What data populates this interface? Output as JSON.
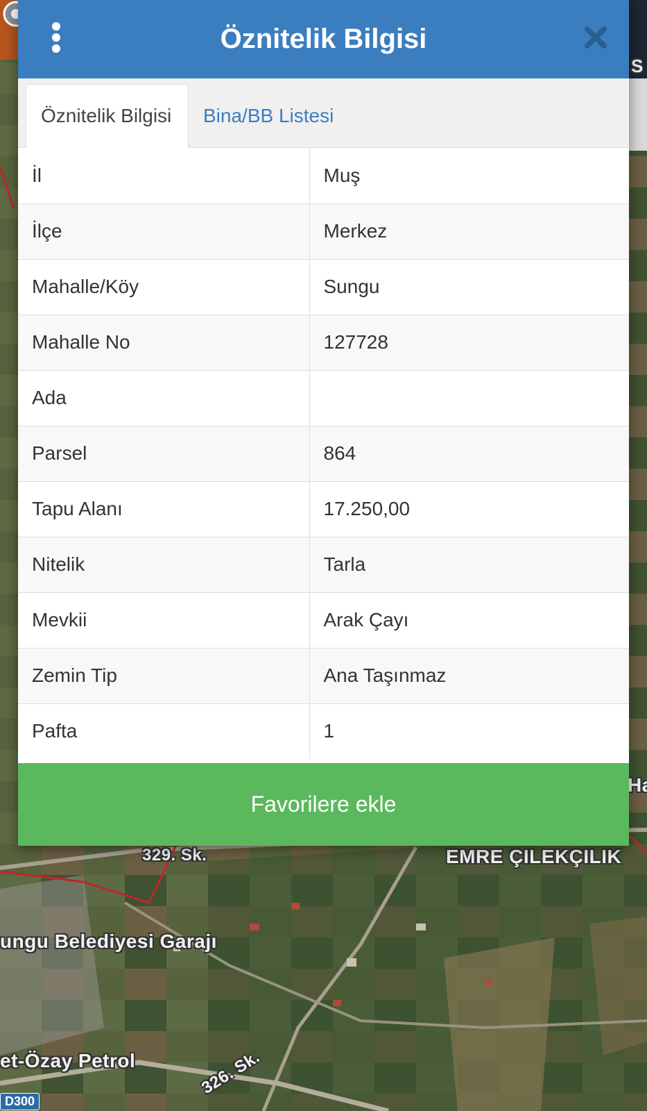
{
  "modal": {
    "title": "Öznitelik Bilgisi",
    "menu_icon": "more-vertical-icon",
    "close_icon": "close-icon",
    "colors": {
      "header": "#3b7ebf",
      "button": "#5cb85c"
    }
  },
  "tabs": [
    {
      "label": "Öznitelik Bilgisi",
      "active": true
    },
    {
      "label": "Bina/BB Listesi",
      "active": false
    }
  ],
  "attributes": [
    {
      "key": "İl",
      "value": "Muş"
    },
    {
      "key": "İlçe",
      "value": "Merkez"
    },
    {
      "key": "Mahalle/Köy",
      "value": "Sungu"
    },
    {
      "key": "Mahalle No",
      "value": "127728"
    },
    {
      "key": "Ada",
      "value": ""
    },
    {
      "key": "Parsel",
      "value": "864"
    },
    {
      "key": "Tapu Alanı",
      "value": "17.250,00"
    },
    {
      "key": "Nitelik",
      "value": "Tarla"
    },
    {
      "key": "Mevkii",
      "value": "Arak Çayı"
    },
    {
      "key": "Zemin Tip",
      "value": "Ana Taşınmaz"
    },
    {
      "key": "Pafta",
      "value": "1"
    }
  ],
  "favorite_button": {
    "label": "Favorilere ekle"
  },
  "map": {
    "labels": {
      "road_329": "329. Sk.",
      "poi_emre": "EMRE ÇILEKÇILIK",
      "poi_garaj": "ungu Belediyesi Garajı",
      "poi_petrol": "et-Özay Petrol",
      "road_326": "326. Sk.",
      "shield": "D300",
      "edge_ha": "Ha",
      "edge_s": "S"
    }
  }
}
